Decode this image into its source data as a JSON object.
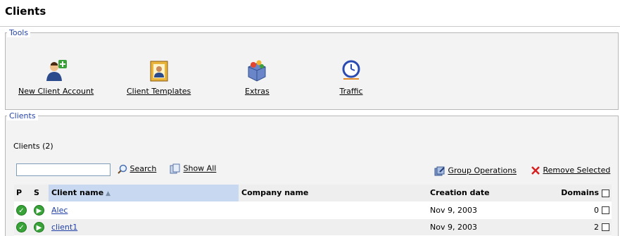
{
  "page": {
    "title": "Clients"
  },
  "tools": {
    "legend": "Tools",
    "items": [
      {
        "label": "New Client Account",
        "icon": "new-client-icon"
      },
      {
        "label": "Client Templates",
        "icon": "client-templates-icon"
      },
      {
        "label": "Extras",
        "icon": "extras-icon"
      },
      {
        "label": "Traffic",
        "icon": "traffic-clock-icon"
      }
    ]
  },
  "clients": {
    "legend": "Clients",
    "count_label": "Clients (2)",
    "search": {
      "value": "",
      "button_label": "Search",
      "show_all_label": "Show All"
    },
    "group_operations_label": "Group Operations",
    "remove_selected_label": "Remove Selected",
    "columns": {
      "p": "P",
      "s": "S",
      "client_name": "Client name",
      "company_name": "Company name",
      "creation_date": "Creation date",
      "domains": "Domains"
    },
    "rows": [
      {
        "client_name": "Alec",
        "company_name": "",
        "creation_date": "Nov 9, 2003",
        "domains": "0"
      },
      {
        "client_name": "client1",
        "company_name": "",
        "creation_date": "Nov 9, 2003",
        "domains": "2"
      }
    ]
  },
  "colors": {
    "legend": "#2443a8",
    "link": "#1f3fa5",
    "status_ok": "#39a239",
    "remove_icon": "#d42020"
  }
}
